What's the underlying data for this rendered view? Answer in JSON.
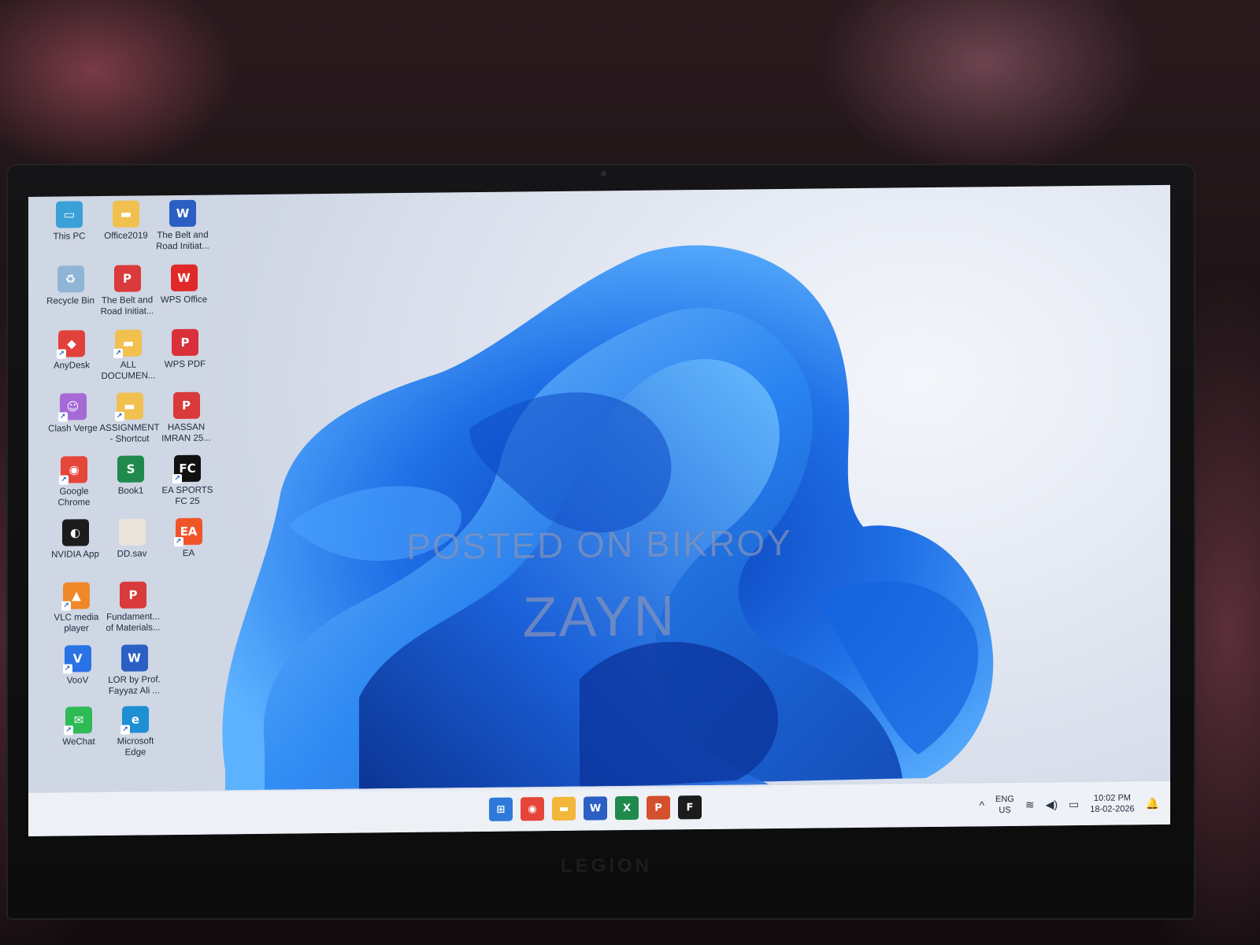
{
  "desktop": {
    "icons": [
      {
        "label": "This PC",
        "icon": "monitor-icon",
        "color": "#3aa0d8",
        "glyph": "▭"
      },
      {
        "label": "Office2019",
        "icon": "folder-icon",
        "color": "#f2c04e",
        "glyph": "▬"
      },
      {
        "label": "The Belt and Road Initiat...",
        "icon": "word-doc-icon",
        "color": "#2b5fc4",
        "glyph": "W"
      },
      {
        "label": "Recycle Bin",
        "icon": "recycle-bin-icon",
        "color": "#8fb4d6",
        "glyph": "♻"
      },
      {
        "label": "The Belt and Road Initiat...",
        "icon": "pdf-doc-icon",
        "color": "#d93a3a",
        "glyph": "P"
      },
      {
        "label": "WPS Office",
        "icon": "wps-office-icon",
        "color": "#e02a2a",
        "glyph": "W"
      },
      {
        "label": "AnyDesk",
        "icon": "anydesk-icon",
        "color": "#e2413b",
        "glyph": "◆"
      },
      {
        "label": "ALL DOCUMEN...",
        "icon": "folder-shortcut-icon",
        "color": "#f2c04e",
        "glyph": "▬"
      },
      {
        "label": "WPS PDF",
        "icon": "wps-pdf-icon",
        "color": "#d9303a",
        "glyph": "P"
      },
      {
        "label": "Clash Verge",
        "icon": "clash-verge-icon",
        "color": "#a66ad6",
        "glyph": "☺"
      },
      {
        "label": "ASSIGNMENT - Shortcut",
        "icon": "folder-shortcut-icon",
        "color": "#f2c04e",
        "glyph": "▬"
      },
      {
        "label": "HASSAN IMRAN 25...",
        "icon": "pdf-doc-icon",
        "color": "#d93a3a",
        "glyph": "P"
      },
      {
        "label": "Google Chrome",
        "icon": "chrome-icon",
        "color": "#e6453a",
        "glyph": "◉"
      },
      {
        "label": "Book1",
        "icon": "spreadsheet-icon",
        "color": "#1f8a4c",
        "glyph": "S"
      },
      {
        "label": "EA SPORTS FC 25",
        "icon": "ea-sports-fc-icon",
        "color": "#111111",
        "glyph": "FC"
      },
      {
        "label": "NVIDIA App",
        "icon": "nvidia-icon",
        "color": "#1c1c1c",
        "glyph": "◐"
      },
      {
        "label": "DD.sav",
        "icon": "file-icon",
        "color": "#e9e4dc",
        "glyph": " "
      },
      {
        "label": "EA",
        "icon": "ea-icon",
        "color": "#f0552a",
        "glyph": "EA"
      },
      {
        "label": "VLC media player",
        "icon": "vlc-icon",
        "color": "#f0882a",
        "glyph": "▲"
      },
      {
        "label": "Fundament... of Materials...",
        "icon": "pdf-doc-icon",
        "color": "#d93a3a",
        "glyph": "P"
      },
      {
        "label": "VooV",
        "icon": "voov-icon",
        "color": "#2a73e6",
        "glyph": "V"
      },
      {
        "label": "LOR by Prof. Fayyaz Ali ...",
        "icon": "word-doc-icon",
        "color": "#2b5fc4",
        "glyph": "W"
      },
      {
        "label": "WeChat",
        "icon": "wechat-icon",
        "color": "#2dbb55",
        "glyph": "✉"
      },
      {
        "label": "Microsoft Edge",
        "icon": "edge-icon",
        "color": "#1f8fd4",
        "glyph": "e"
      }
    ]
  },
  "watermark": {
    "line1": "POSTED ON BIKROY",
    "line2": "ZAYN"
  },
  "taskbar": {
    "apps": [
      {
        "name": "start-button",
        "icon": "windows-icon",
        "color": "#2f7ad9",
        "glyph": "⊞"
      },
      {
        "name": "chrome-taskbar-button",
        "icon": "chrome-icon",
        "color": "#e6453a",
        "glyph": "◉"
      },
      {
        "name": "file-explorer-button",
        "icon": "folder-icon",
        "color": "#f2b73a",
        "glyph": "▬"
      },
      {
        "name": "word-taskbar-button",
        "icon": "word-icon",
        "color": "#2b5fc4",
        "glyph": "W"
      },
      {
        "name": "excel-taskbar-button",
        "icon": "excel-icon",
        "color": "#1f8a4c",
        "glyph": "X"
      },
      {
        "name": "powerpoint-taskbar-button",
        "icon": "powerpoint-icon",
        "color": "#d4502c",
        "glyph": "P"
      },
      {
        "name": "figma-taskbar-button",
        "icon": "figma-icon",
        "color": "#1c1c1c",
        "glyph": "F"
      }
    ],
    "tray": {
      "chevron": "^",
      "language_top": "ENG",
      "language_bottom": "US",
      "wifi": "≋",
      "volume": "◀)",
      "battery": "▭",
      "time": "10:02 PM",
      "date": "18-02-2026",
      "notification": "🔔"
    }
  },
  "laptop": {
    "brand": "LEGION"
  }
}
